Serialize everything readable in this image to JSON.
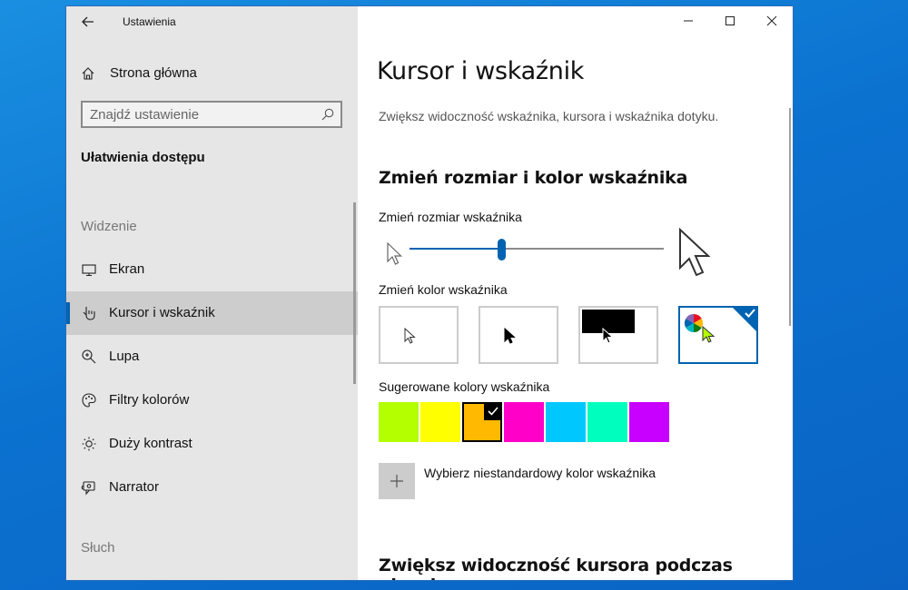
{
  "app": {
    "title": "Ustawienia"
  },
  "sidebar": {
    "home_label": "Strona główna",
    "search_placeholder": "Znajdź ustawienie",
    "category": "Ułatwienia dostępu",
    "group_vision": "Widzenie",
    "items": [
      {
        "label": "Ekran",
        "icon": "monitor-icon"
      },
      {
        "label": "Kursor i wskaźnik",
        "icon": "cursor-icon",
        "active": true
      },
      {
        "label": "Lupa",
        "icon": "magnifier-icon"
      },
      {
        "label": "Filtry kolorów",
        "icon": "palette-icon"
      },
      {
        "label": "Duży kontrast",
        "icon": "brightness-icon"
      },
      {
        "label": "Narrator",
        "icon": "narrator-icon"
      }
    ],
    "group_hearing": "Słuch"
  },
  "main": {
    "title": "Kursor i wskaźnik",
    "description": "Zwiększ widoczność wskaźnika, kursora i wskaźnika dotyku.",
    "section_size_color": "Zmień rozmiar i kolor wskaźnika",
    "size_label": "Zmień rozmiar wskaźnika",
    "size_value": 0.36,
    "color_label": "Zmień kolor wskaźnika",
    "color_options": [
      "white-pointer",
      "black-pointer",
      "inverted-pointer",
      "custom-color-pointer"
    ],
    "selected_color_option": 3,
    "suggested_label": "Sugerowane kolory wskaźnika",
    "suggested_colors": [
      "#b4ff00",
      "#ffff00",
      "#ffb900",
      "#ff00c8",
      "#00c8ff",
      "#00ffbe",
      "#c800ff"
    ],
    "selected_suggested": 2,
    "custom_color_label": "Wybierz niestandardowy kolor wskaźnika",
    "section_text_cursor": "Zwiększ widoczność kursora podczas pisania"
  },
  "colors": {
    "accent": "#0063b1",
    "sidebar_bg": "#e6e6e6",
    "active_bg": "#cdcdcd"
  }
}
